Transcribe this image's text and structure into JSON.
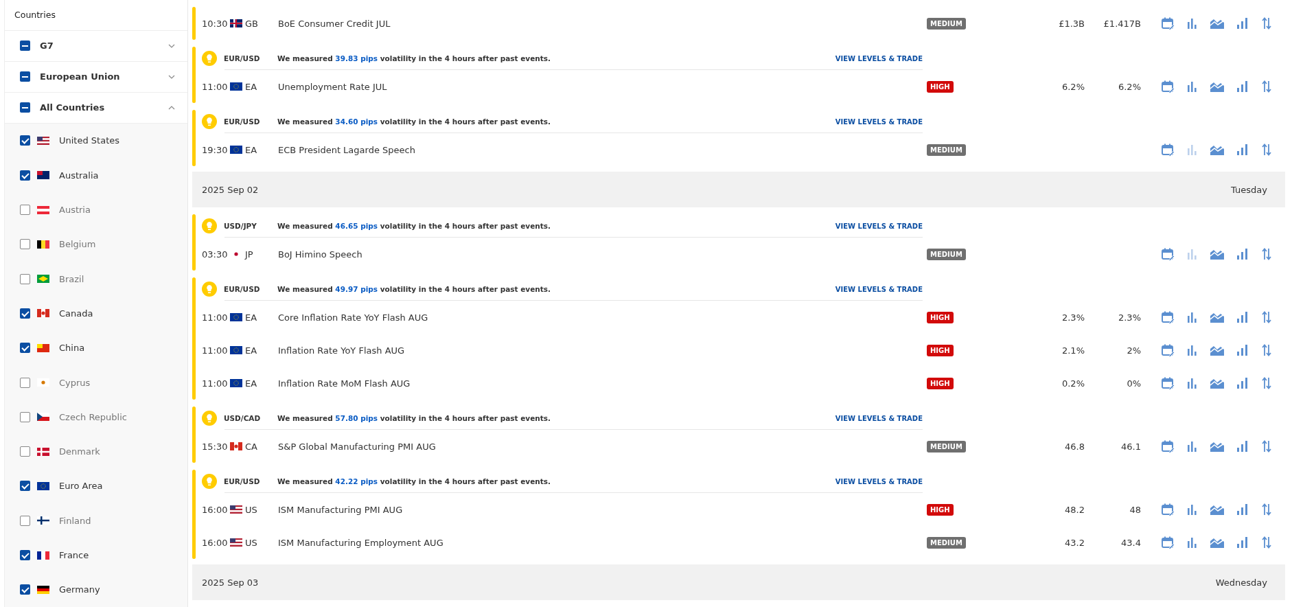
{
  "sidebar": {
    "title": "Countries",
    "groups": [
      {
        "label": "G7",
        "indeterminate": true,
        "expanded": false
      },
      {
        "label": "European Union",
        "indeterminate": true,
        "expanded": false
      },
      {
        "label": "All Countries",
        "indeterminate": true,
        "expanded": true
      }
    ],
    "countries": [
      {
        "name": "United States",
        "kind": "us",
        "checked": true
      },
      {
        "name": "Australia",
        "kind": "au",
        "checked": true
      },
      {
        "name": "Austria",
        "kind": "at",
        "checked": false
      },
      {
        "name": "Belgium",
        "kind": "be",
        "checked": false
      },
      {
        "name": "Brazil",
        "kind": "br",
        "checked": false
      },
      {
        "name": "Canada",
        "kind": "ca",
        "checked": true
      },
      {
        "name": "China",
        "kind": "cn",
        "checked": true
      },
      {
        "name": "Cyprus",
        "kind": "cy",
        "checked": false
      },
      {
        "name": "Czech Republic",
        "kind": "cz",
        "checked": false
      },
      {
        "name": "Denmark",
        "kind": "dk",
        "checked": false
      },
      {
        "name": "Euro Area",
        "kind": "eu",
        "checked": true
      },
      {
        "name": "Finland",
        "kind": "fi",
        "checked": false
      },
      {
        "name": "France",
        "kind": "fr",
        "checked": true
      },
      {
        "name": "Germany",
        "kind": "de",
        "checked": true
      }
    ]
  },
  "sections": [
    {
      "groups": [
        {
          "events": [
            {
              "time": "10:30",
              "kind": "gb",
              "code": "GB",
              "name": "BoE Consumer Credit JUL",
              "impact": "MEDIUM",
              "color": "#6f6f6f",
              "values": [
                "£1.3B",
                "£1.417B"
              ],
              "chart_disabled": false
            }
          ]
        },
        {
          "alert": {
            "pair": "EUR/USD",
            "before": "We measured ",
            "pips": "39.83 pips",
            "after": " volatility in the 4 hours after past events.",
            "link": "VIEW LEVELS & TRADE"
          },
          "events": [
            {
              "time": "11:00",
              "kind": "eu",
              "code": "EA",
              "name": "Unemployment Rate JUL",
              "impact": "HIGH",
              "color": "#d20a0a",
              "values": [
                "6.2%",
                "6.2%"
              ],
              "chart_disabled": false
            }
          ]
        },
        {
          "alert": {
            "pair": "EUR/USD",
            "before": "We measured ",
            "pips": "34.60 pips",
            "after": " volatility in the 4 hours after past events.",
            "link": "VIEW LEVELS & TRADE"
          },
          "events": [
            {
              "time": "19:30",
              "kind": "eu",
              "code": "EA",
              "name": "ECB President Lagarde Speech",
              "impact": "MEDIUM",
              "color": "#6f6f6f",
              "chart_disabled": true
            }
          ]
        }
      ]
    },
    {
      "date": "2025 Sep 02",
      "weekday": "Tuesday",
      "groups": [
        {
          "alert": {
            "pair": "USD/JPY",
            "before": "We measured ",
            "pips": "46.65 pips",
            "after": " volatility in the 4 hours after past events.",
            "link": "VIEW LEVELS & TRADE"
          },
          "events": [
            {
              "time": "03:30",
              "kind": "jp",
              "code": "JP",
              "name": "BoJ Himino Speech",
              "impact": "MEDIUM",
              "color": "#6f6f6f",
              "chart_disabled": true
            }
          ]
        },
        {
          "alert": {
            "pair": "EUR/USD",
            "before": "We measured ",
            "pips": "49.97 pips",
            "after": " volatility in the 4 hours after past events.",
            "link": "VIEW LEVELS & TRADE"
          },
          "events": [
            {
              "time": "11:00",
              "kind": "eu",
              "code": "EA",
              "name": "Core Inflation Rate YoY Flash AUG",
              "impact": "HIGH",
              "color": "#d20a0a",
              "values": [
                "2.3%",
                "2.3%"
              ],
              "chart_disabled": false
            },
            {
              "time": "11:00",
              "kind": "eu",
              "code": "EA",
              "name": "Inflation Rate YoY Flash AUG",
              "impact": "HIGH",
              "color": "#d20a0a",
              "values": [
                "2.1%",
                "2%"
              ],
              "chart_disabled": false
            },
            {
              "time": "11:00",
              "kind": "eu",
              "code": "EA",
              "name": "Inflation Rate MoM Flash AUG",
              "impact": "HIGH",
              "color": "#d20a0a",
              "values": [
                "0.2%",
                "0%"
              ],
              "chart_disabled": false
            }
          ]
        },
        {
          "alert": {
            "pair": "USD/CAD",
            "before": "We measured ",
            "pips": "57.80 pips",
            "after": " volatility in the 4 hours after past events.",
            "link": "VIEW LEVELS & TRADE"
          },
          "events": [
            {
              "time": "15:30",
              "kind": "ca",
              "code": "CA",
              "name": "S&P Global Manufacturing PMI AUG",
              "impact": "MEDIUM",
              "color": "#6f6f6f",
              "values": [
                "46.8",
                "46.1"
              ],
              "chart_disabled": false
            }
          ]
        },
        {
          "alert": {
            "pair": "EUR/USD",
            "before": "We measured ",
            "pips": "42.22 pips",
            "after": " volatility in the 4 hours after past events.",
            "link": "VIEW LEVELS & TRADE"
          },
          "events": [
            {
              "time": "16:00",
              "kind": "us",
              "code": "US",
              "name": "ISM Manufacturing PMI AUG",
              "impact": "HIGH",
              "color": "#d20a0a",
              "values": [
                "48.2",
                "48"
              ],
              "chart_disabled": false
            },
            {
              "time": "16:00",
              "kind": "us",
              "code": "US",
              "name": "ISM Manufacturing Employment AUG",
              "impact": "MEDIUM",
              "color": "#6f6f6f",
              "values": [
                "43.2",
                "43.4"
              ],
              "chart_disabled": false
            }
          ]
        }
      ]
    },
    {
      "date": "2025 Sep 03",
      "weekday": "Wednesday"
    }
  ]
}
